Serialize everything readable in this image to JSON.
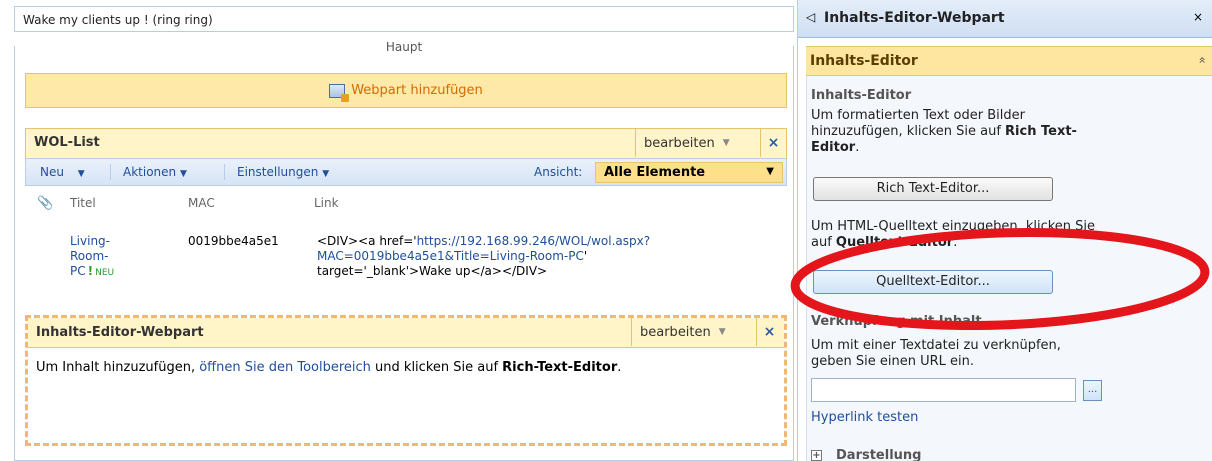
{
  "page": {
    "title": "Wake my clients up ! (ring ring)",
    "zone_label": "Haupt",
    "add_webpart_label": "Webpart hinzufügen"
  },
  "wol_list": {
    "title": "WOL-List",
    "edit_label": "bearbeiten",
    "close_label": "×",
    "toolbar": {
      "new": "Neu",
      "actions": "Aktionen",
      "settings": "Einstellungen",
      "view_label": "Ansicht:",
      "view_value": "Alle Elemente"
    },
    "columns": [
      "Titel",
      "MAC",
      "Link"
    ],
    "rows": [
      {
        "title_line1": "Living-",
        "title_line2": "Room-",
        "title_line3": "PC",
        "new_badge": "NEU",
        "mac": "0019bbe4a5e1",
        "link_prefix": "<DIV><a href='",
        "link_url1": "https://192.168.99.246/WOL/wol.aspx?",
        "link_url2": "MAC=0019bbe4a5e1&Title=Living-Room-PC",
        "link_suffix1": "'",
        "link_suffix2": "target='_blank'>Wake up</a></DIV>"
      }
    ]
  },
  "content_editor": {
    "title": "Inhalts-Editor-Webpart",
    "edit_label": "bearbeiten",
    "close_label": "×",
    "body_prefix": "Um Inhalt hinzuzufügen, ",
    "body_link": "öffnen Sie den Toolbereich",
    "body_middle": " und klicken Sie auf ",
    "body_bold": "Rich-Text-Editor",
    "body_suffix": "."
  },
  "tool_pane": {
    "title": "Inhalts-Editor-Webpart",
    "back_icon": "◁",
    "close_label": "×",
    "section_title": "Inhalts-Editor",
    "collapse_icon": "«",
    "heading": "Inhalts-Editor",
    "rich_text_desc_1": "Um formatierten Text oder Bilder",
    "rich_text_desc_2": "hinzuzufügen, klicken Sie auf ",
    "rich_text_desc_bold": "Rich Text-",
    "rich_text_desc_3": "Editor",
    "rich_text_button": "Rich Text-Editor...",
    "html_desc_1": "Um HTML-Quelltext einzugeben, klicken Sie",
    "html_desc_2": "auf ",
    "html_desc_bold": "Quelltext-Editor",
    "source_button": "Quelltext-Editor...",
    "link_heading": "Verknüpfung mit Inhalt",
    "link_desc_1": "Um mit einer Textdatei zu verknüpfen,",
    "link_desc_2": "geben Sie einen URL ein.",
    "url_value": "",
    "browse_button": "...",
    "hyperlink_test": "Hyperlink testen",
    "appearance": "Darstellung",
    "expand_icon": "+"
  },
  "colors": {
    "accent_blue": "#1f4e9b",
    "header_gold": "#ffe6a0",
    "annotation_red": "#e4151b"
  }
}
